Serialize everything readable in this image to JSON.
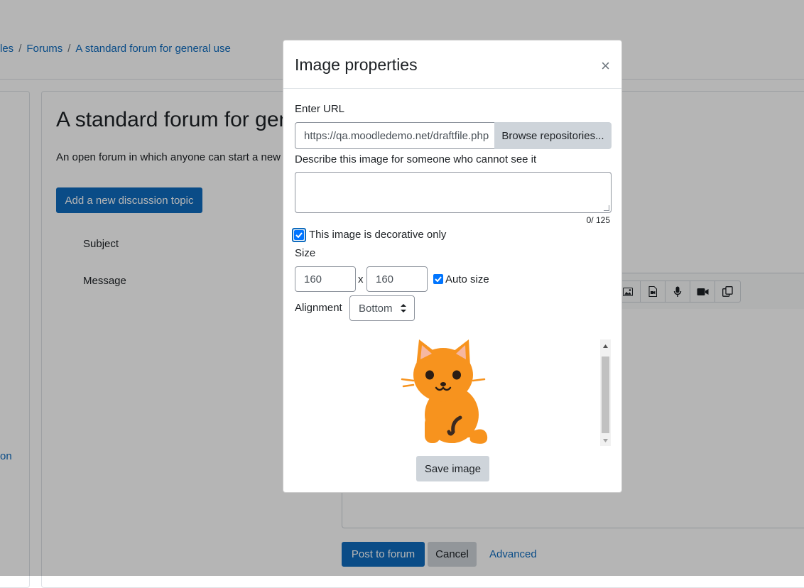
{
  "breadcrumb": {
    "items": [
      "les",
      "Forums",
      "A standard forum for general use"
    ],
    "separator": "/"
  },
  "left_nav": {
    "partial_link": "on"
  },
  "forum": {
    "title": "A standard forum for gen",
    "description": "An open forum in which anyone can start a new",
    "add_topic_label": "Add a new discussion topic",
    "subject_label": "Subject",
    "message_label": "Message",
    "toolbar_icons": [
      "image-icon",
      "media-icon",
      "microphone-icon",
      "video-camera-icon",
      "manage-files-icon"
    ],
    "post_label": "Post to forum",
    "cancel_label": "Cancel",
    "advanced_label": "Advanced"
  },
  "dialog": {
    "title": "Image properties",
    "close_symbol": "×",
    "url_label": "Enter URL",
    "url_value": "https://qa.moodledemo.net/draftfile.php",
    "browse_label": "Browse repositories...",
    "alt_label": "Describe this image for someone who cannot see it",
    "alt_value": "",
    "char_count": "0/ 125",
    "decorative_label": "This image is decorative only",
    "decorative_checked": true,
    "size_label": "Size",
    "width": "160",
    "size_separator": "x",
    "height": "160",
    "auto_size_label": "Auto size",
    "auto_size_checked": true,
    "alignment_label": "Alignment",
    "alignment_value": "Bottom",
    "preview_image": "orange-cat",
    "save_label": "Save image"
  },
  "colors": {
    "primary": "#0f6cbf",
    "secondary_button": "#ced4da",
    "backdrop": "rgba(0,0,0,0.29)",
    "cat": "#f7931e"
  }
}
